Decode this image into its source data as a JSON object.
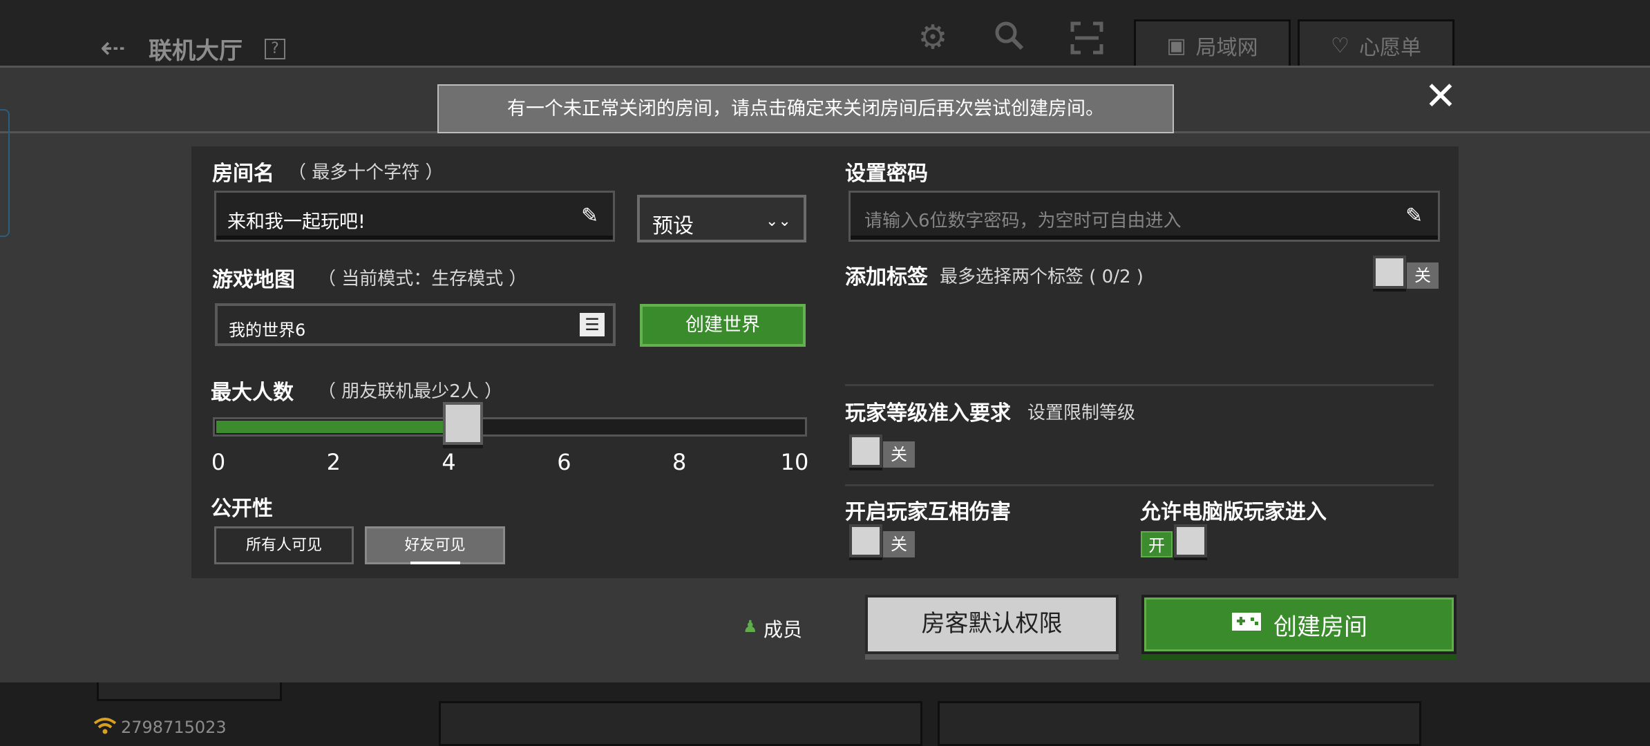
{
  "background": {
    "title": "联机大厅",
    "help": "?",
    "top_buttons": [
      {
        "label": "局域网",
        "icon": "lan-icon"
      },
      {
        "label": "心愿单",
        "icon": "heart-icon"
      }
    ],
    "player_id": "2798715023"
  },
  "notice": "有一个未正常关闭的房间，请点击确定来关闭房间后再次尝试创建房间。",
  "room_name": {
    "label": "房间名",
    "hint": "（ 最多十个字符 ）",
    "value": "来和我一起玩吧!",
    "preset_label": "预设"
  },
  "password": {
    "label": "设置密码",
    "placeholder": "请输入6位数字密码，为空时可自由进入"
  },
  "game_map": {
    "label": "游戏地图",
    "hint": "（ 当前模式：生存模式 ）",
    "value": "我的世界6",
    "create_world_label": "创建世界"
  },
  "tags": {
    "label": "添加标签",
    "hint": "最多选择两个标签 ( 0/2 )",
    "toggle": "关"
  },
  "max_players": {
    "label": "最大人数",
    "hint": "（ 朋友联机最少2人 ）",
    "ticks": [
      "0",
      "2",
      "4",
      "6",
      "8",
      "10"
    ],
    "value": 4,
    "max": 10
  },
  "level_req": {
    "label": "玩家等级准入要求",
    "hint": "设置限制等级",
    "toggle": "关"
  },
  "visibility": {
    "label": "公开性",
    "options": [
      "所有人可见",
      "好友可见"
    ],
    "selected": "好友可见"
  },
  "pvp": {
    "label": "开启玩家互相伤害",
    "toggle": "关"
  },
  "pc_players": {
    "label": "允许电脑版玩家进入",
    "toggle": "开"
  },
  "footer": {
    "members": "成员",
    "permissions": "房客默认权限",
    "create_room": "创建房间"
  },
  "colors": {
    "accent_green": "#3a8b2c",
    "panel": "#2b2b2b",
    "dialog": "#393939"
  }
}
